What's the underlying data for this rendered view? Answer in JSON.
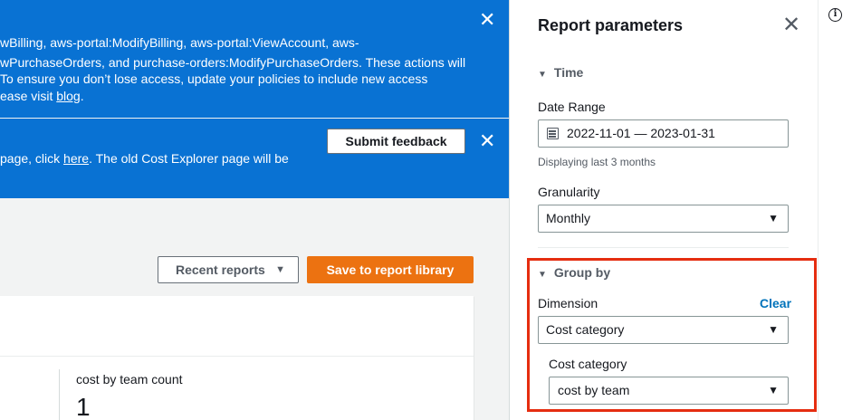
{
  "flash_info": {
    "line1": "wBilling, aws-portal:ModifyBilling, aws-portal:ViewAccount, aws-",
    "line2": "wPurchaseOrders, and purchase-orders:ModifyPurchaseOrders. These actions will",
    "line3": " To ensure you don’t lose access, update your policies to include new access",
    "line4_prefix": "ease visit ",
    "line4_link": "blog",
    "line4_suffix": ".",
    "close_icon": "close-icon"
  },
  "flash_feedback": {
    "text_prefix": "page, click ",
    "text_link": "here",
    "text_suffix": ". The old Cost Explorer page will be",
    "button_label": "Submit feedback",
    "close_icon": "close-icon"
  },
  "toolbar": {
    "recent_reports_label": "Recent reports",
    "save_label": "Save to report library"
  },
  "metric": {
    "label": "cost by team count",
    "value": "1"
  },
  "panel": {
    "title": "Report parameters",
    "time": {
      "header": "Time",
      "date_range_label": "Date Range",
      "date_range_value": "2022-11-01 — 2023-01-31",
      "date_range_hint": "Displaying last 3 months",
      "granularity_label": "Granularity",
      "granularity_value": "Monthly"
    },
    "group_by": {
      "header": "Group by",
      "dimension_label": "Dimension",
      "clear_label": "Clear",
      "dimension_value": "Cost category",
      "cost_category_label": "Cost category",
      "cost_category_value": "cost by team"
    }
  },
  "colors": {
    "flash_bg": "#0972d3",
    "primary_button": "#ec7211",
    "highlight_border": "#e52d10",
    "link": "#0073bb"
  }
}
